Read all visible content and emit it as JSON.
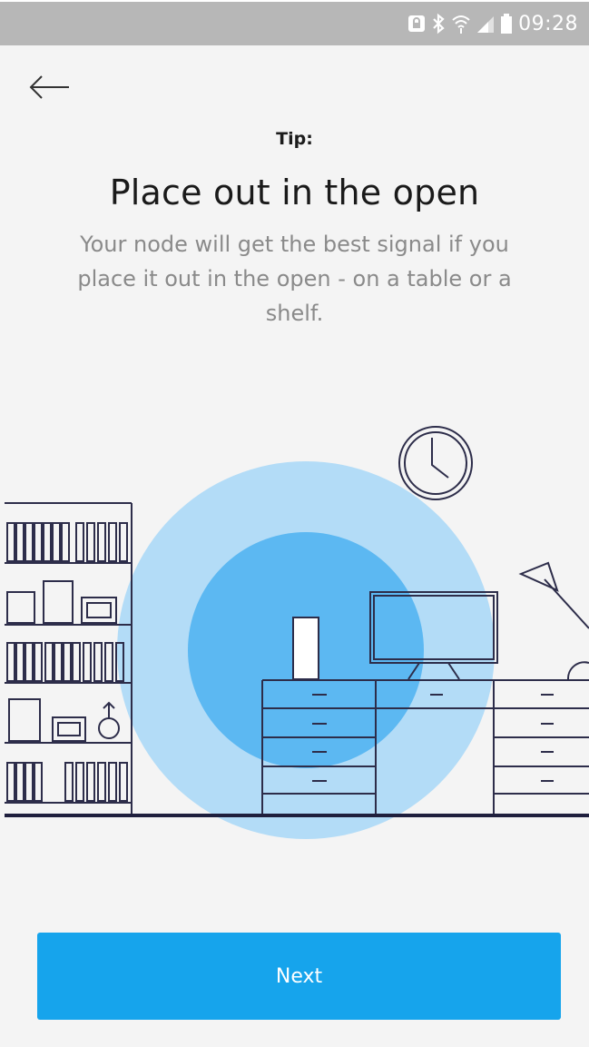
{
  "status_bar": {
    "time": "09:28"
  },
  "header": {
    "back_icon": "arrow-left-icon"
  },
  "content": {
    "tip_label": "Tip:",
    "title": "Place out in the open",
    "description": "Your node will get the best signal if you place it out in the open - on a table or a shelf."
  },
  "actions": {
    "next_label": "Next"
  },
  "colors": {
    "accent": "#16a4ec",
    "signal_outer": "#b3dcf7",
    "signal_inner": "#5cb8f2",
    "line": "#2d2d4a"
  }
}
